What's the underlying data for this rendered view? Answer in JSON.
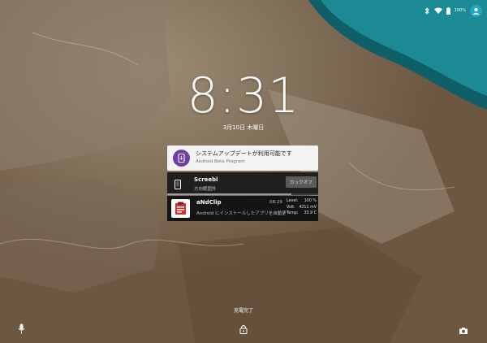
{
  "status_bar": {
    "battery_percent": "100%",
    "icons": [
      "bluetooth-icon",
      "wifi-icon",
      "battery-icon",
      "user-icon"
    ],
    "accent_color": "#1fa6c9"
  },
  "lockscreen": {
    "time": "8:31",
    "date": "3月10日 木曜日",
    "charging_text": "充電完了"
  },
  "notifications": [
    {
      "title": "システムアップデートが利用可能です",
      "subtitle": "Android Beta Program",
      "icon": "system-update-icon",
      "icon_color": "#6f3fa3"
    },
    {
      "title": "Screebl",
      "subtitle": "方向範囲外",
      "action_label": "ロックオフ",
      "icon": "phone-icon",
      "progress": 0.82
    },
    {
      "title": "aNdClip",
      "time": "08:29",
      "subtitle": "Android にインストールしたアプリを自動更新...",
      "icon": "clipboard-icon",
      "stats": [
        {
          "label": "Level:",
          "value": "100 %"
        },
        {
          "label": "Volt:",
          "value": "4211 mV"
        },
        {
          "label": "Temp:",
          "value": "33.9 C"
        }
      ]
    }
  ],
  "bottom_bar": {
    "icons": [
      "microphone-icon",
      "lock-icon",
      "camera-icon"
    ]
  }
}
